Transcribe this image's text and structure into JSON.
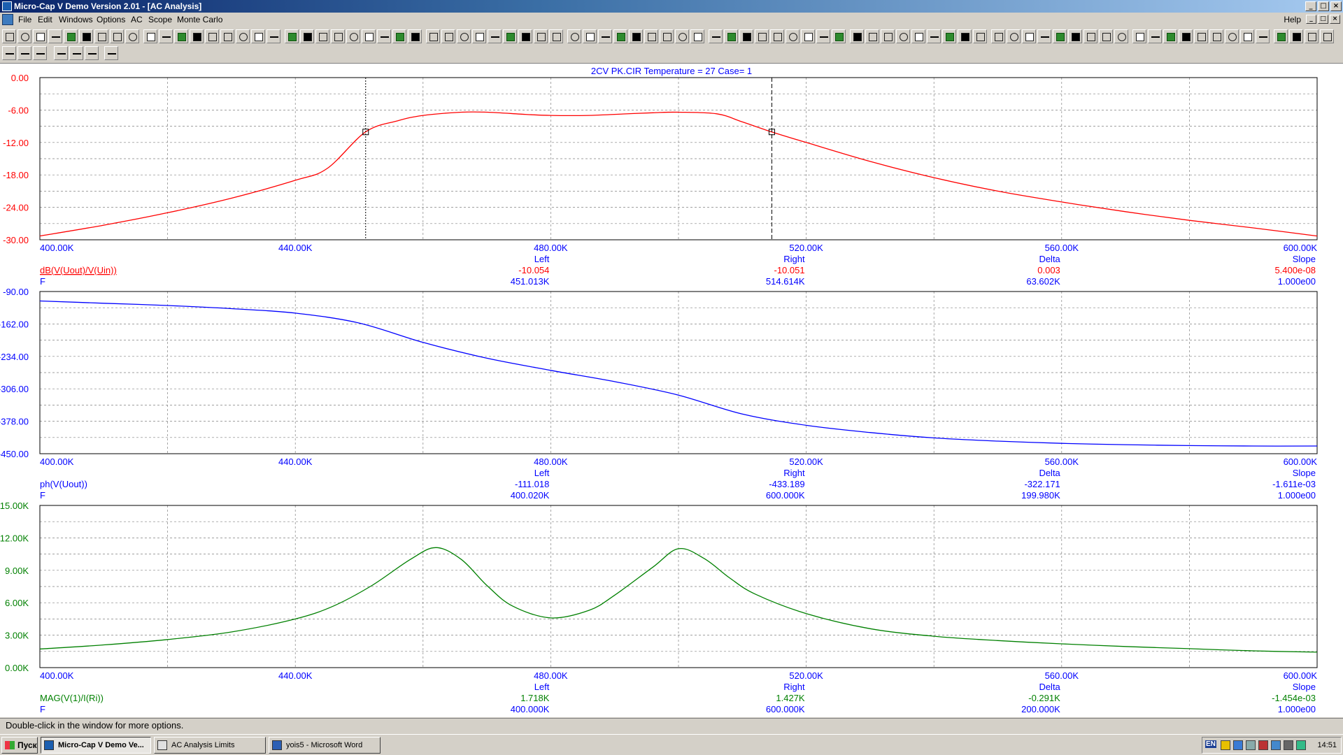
{
  "window": {
    "title": "Micro-Cap V Demo Version 2.01 - [AC Analysis]"
  },
  "menu": {
    "items": [
      "File",
      "Edit",
      "Windows",
      "Options",
      "AC",
      "Scope",
      "Monte Carlo"
    ],
    "help": "Help"
  },
  "plot": {
    "heading": "2CV  PK.CIR Temperature = 27 Case= 1",
    "x_ticks": [
      "400.00K",
      "440.00K",
      "480.00K",
      "520.00K",
      "560.00K",
      "600.00K"
    ],
    "x_range": [
      400,
      600
    ],
    "panels": [
      {
        "expr": "dB(V(Uout)/V(Uin))",
        "xvar": "F",
        "color": "#ff0000",
        "y_ticks": [
          "0.00",
          "-6.00",
          "-12.00",
          "-18.00",
          "-24.00",
          "-30.00"
        ],
        "ylim": [
          -30,
          0
        ],
        "readout": {
          "headers": [
            "Left",
            "Right",
            "Delta",
            "Slope"
          ],
          "y": [
            "-10.054",
            "-10.051",
            "0.003",
            "5.400e-08"
          ],
          "x": [
            "451.013K",
            "514.614K",
            "63.602K",
            "1.000e00"
          ]
        },
        "cursors": [
          451.013,
          514.614
        ]
      },
      {
        "expr": "ph(V(Uout))",
        "xvar": "F",
        "color": "#0000ff",
        "y_ticks": [
          "-90.00",
          "-162.00",
          "-234.00",
          "-306.00",
          "-378.00",
          "-450.00"
        ],
        "ylim": [
          -450,
          -90
        ],
        "readout": {
          "headers": [
            "Left",
            "Right",
            "Delta",
            "Slope"
          ],
          "y": [
            "-111.018",
            "-433.189",
            "-322.171",
            "-1.611e-03"
          ],
          "x": [
            "400.020K",
            "600.000K",
            "199.980K",
            "1.000e00"
          ]
        }
      },
      {
        "expr": "MAG(V(1)/I(Ri))",
        "xvar": "F",
        "color": "#008000",
        "y_ticks": [
          "15.00K",
          "12.00K",
          "9.00K",
          "6.00K",
          "3.00K",
          "0.00K"
        ],
        "ylim": [
          0,
          15
        ],
        "readout": {
          "headers": [
            "Left",
            "Right",
            "Delta",
            "Slope"
          ],
          "y": [
            "1.718K",
            "1.427K",
            "-0.291K",
            "-1.454e-03"
          ],
          "x": [
            "400.000K",
            "600.000K",
            "200.000K",
            "1.000e00"
          ]
        }
      }
    ]
  },
  "chart_data": [
    {
      "type": "line",
      "title": "2CV  PK.CIR Temperature = 27 Case= 1",
      "xlabel": "F",
      "ylabel": "dB(V(Uout)/V(Uin))",
      "xlim": [
        400,
        600
      ],
      "ylim": [
        -30,
        0
      ],
      "x_unit": "K",
      "grid": true,
      "series": [
        {
          "name": "dB(V(Uout)/V(Uin))",
          "x": [
            400,
            410,
            420,
            430,
            440,
            445,
            451,
            456,
            460,
            466,
            470,
            476,
            480,
            486,
            490,
            496,
            500,
            506,
            510,
            514.6,
            520,
            530,
            540,
            550,
            560,
            570,
            580,
            590,
            600
          ],
          "y": [
            -29.3,
            -27.3,
            -25.0,
            -22.3,
            -19.0,
            -16.8,
            -10.05,
            -8.0,
            -7.0,
            -6.4,
            -6.4,
            -6.8,
            -7.0,
            -7.0,
            -6.8,
            -6.5,
            -6.4,
            -6.7,
            -8.2,
            -10.05,
            -12.0,
            -15.5,
            -18.5,
            -21.0,
            -23.0,
            -24.8,
            -26.4,
            -27.8,
            -29.3
          ]
        }
      ]
    },
    {
      "type": "line",
      "xlabel": "F",
      "ylabel": "ph(V(Uout))",
      "xlim": [
        400,
        600
      ],
      "ylim": [
        -450,
        -90
      ],
      "x_unit": "K",
      "grid": true,
      "series": [
        {
          "name": "ph(V(Uout))",
          "x": [
            400,
            410,
            420,
            430,
            440,
            450,
            460,
            470,
            480,
            490,
            500,
            510,
            520,
            530,
            540,
            550,
            560,
            570,
            580,
            590,
            600
          ],
          "y": [
            -111,
            -116,
            -121,
            -128,
            -138,
            -160,
            -203,
            -238,
            -265,
            -290,
            -320,
            -362,
            -387,
            -403,
            -415,
            -422,
            -427,
            -430,
            -432,
            -433,
            -433
          ]
        }
      ]
    },
    {
      "type": "line",
      "xlabel": "F",
      "ylabel": "MAG(V(1)/I(Ri))",
      "xlim": [
        400,
        600
      ],
      "ylim": [
        0,
        15
      ],
      "y_unit": "K",
      "x_unit": "K",
      "grid": true,
      "series": [
        {
          "name": "MAG(V(1)/I(Ri))",
          "x": [
            400,
            410,
            420,
            430,
            440,
            446,
            452,
            458,
            462,
            466,
            470,
            474,
            480,
            486,
            490,
            496,
            500,
            504,
            508,
            512,
            520,
            530,
            540,
            550,
            560,
            570,
            580,
            590,
            600
          ],
          "y": [
            1.72,
            2.1,
            2.6,
            3.3,
            4.5,
            5.7,
            7.6,
            10.0,
            11.1,
            10.0,
            7.6,
            5.7,
            4.6,
            5.3,
            6.7,
            9.3,
            11.0,
            10.1,
            8.3,
            6.8,
            5.0,
            3.6,
            2.9,
            2.5,
            2.2,
            1.95,
            1.75,
            1.55,
            1.43
          ]
        }
      ]
    }
  ],
  "status": {
    "text": "Double-click in the window for more options."
  },
  "taskbar": {
    "start": "Пуск",
    "tasks": [
      "Micro-Cap V Demo Ve...",
      "AC Analysis Limits",
      "yois5 - Microsoft Word"
    ],
    "lang": "EN",
    "clock": "14:51"
  }
}
